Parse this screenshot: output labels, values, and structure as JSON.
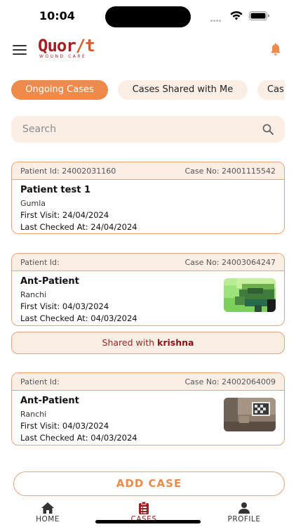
{
  "status_bar": {
    "time": "10:04"
  },
  "header": {
    "logo_main_a": "Quor",
    "logo_main_b": "/t",
    "logo_sub": "WOUND CARE"
  },
  "tabs": [
    {
      "label": "Ongoing Cases",
      "active": true
    },
    {
      "label": "Cases Shared with Me",
      "active": false
    },
    {
      "label": "Cas",
      "active": false
    }
  ],
  "search": {
    "placeholder": "Search",
    "value": ""
  },
  "cases": [
    {
      "patient_id_label": "Patient Id: 24002031160",
      "case_no_label": "Case No: 24001115542",
      "name": "Patient test 1",
      "location": "Gumla",
      "first_visit": "First Visit: 24/04/2024",
      "last_checked": "Last Checked At: 24/04/2024"
    },
    {
      "patient_id_label": "Patient Id:",
      "case_no_label": "Case No: 24003064247",
      "name": "Ant-Patient",
      "location": "Ranchi",
      "first_visit": "First Visit: 04/03/2024",
      "last_checked": "Last Checked At: 04/03/2024"
    },
    {
      "patient_id_label": "Patient Id:",
      "case_no_label": "Case No: 24002064009",
      "name": "Ant-Patient",
      "location": "Ranchi",
      "first_visit": "First Visit: 04/03/2024",
      "last_checked": "Last Checked At: 04/03/2024"
    }
  ],
  "shared": {
    "prefix": "Shared with",
    "user": "krishna"
  },
  "add_case_label": "ADD CASE",
  "nav": [
    {
      "label": "HOME",
      "icon": "home-icon",
      "active": false
    },
    {
      "label": "CASES",
      "icon": "clipboard-icon",
      "active": true
    },
    {
      "label": "PROFILE",
      "icon": "person-icon",
      "active": false
    }
  ],
  "colors": {
    "accent": "#ef8a4b",
    "brand_red": "#a51e22",
    "chip_bg": "#fbeee5",
    "border": "#e9a27a"
  }
}
